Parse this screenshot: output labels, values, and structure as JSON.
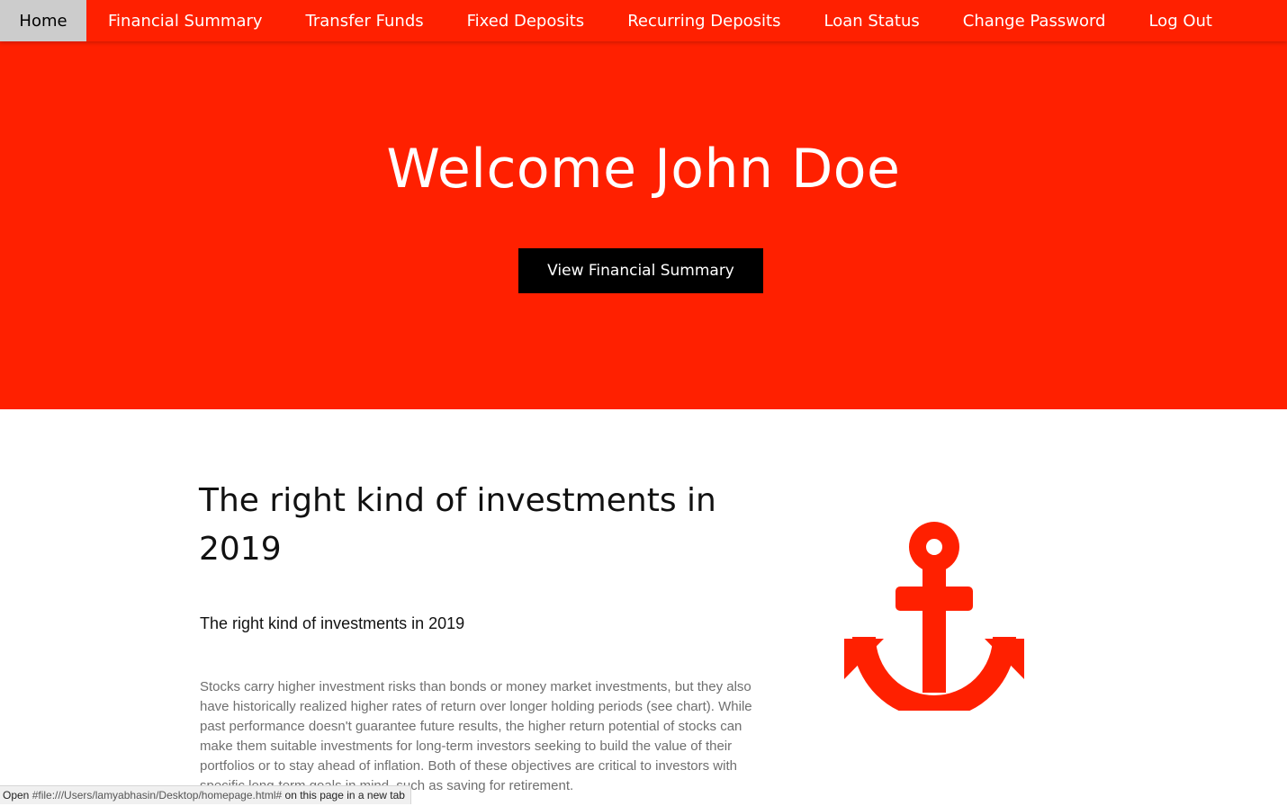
{
  "nav": {
    "items": [
      {
        "label": "Home",
        "active": true
      },
      {
        "label": "Financial Summary"
      },
      {
        "label": "Transfer Funds"
      },
      {
        "label": "Fixed Deposits"
      },
      {
        "label": "Recurring Deposits"
      },
      {
        "label": "Loan Status"
      },
      {
        "label": "Change Password"
      },
      {
        "label": "Log Out"
      }
    ]
  },
  "hero": {
    "title": "Welcome John Doe",
    "button_label": "View Financial Summary"
  },
  "section": {
    "heading": "The right kind of investments in 2019",
    "subheading": "The right kind of investments in 2019",
    "body": "Stocks carry higher investment risks than bonds or money market investments, but they also have historically realized higher rates of return over longer holding periods (see chart). While past performance doesn't guarantee future results, the higher return potential of stocks can make them suitable investments for long-term investors seeking to build the value of their portfolios or to stay ahead of inflation. Both of these objectives are critical to investors with specific long-term goals in mind, such as saving for retirement.",
    "icon": "anchor-icon"
  },
  "status_bar": {
    "prefix": "Open ",
    "url": "#file:///Users/lamyabhasin/Desktop/homepage.html#",
    "suffix": " on this page in a new tab"
  },
  "colors": {
    "brand_red": "#ff2000",
    "active_tab_bg": "#cccccc",
    "button_bg": "#000000"
  }
}
